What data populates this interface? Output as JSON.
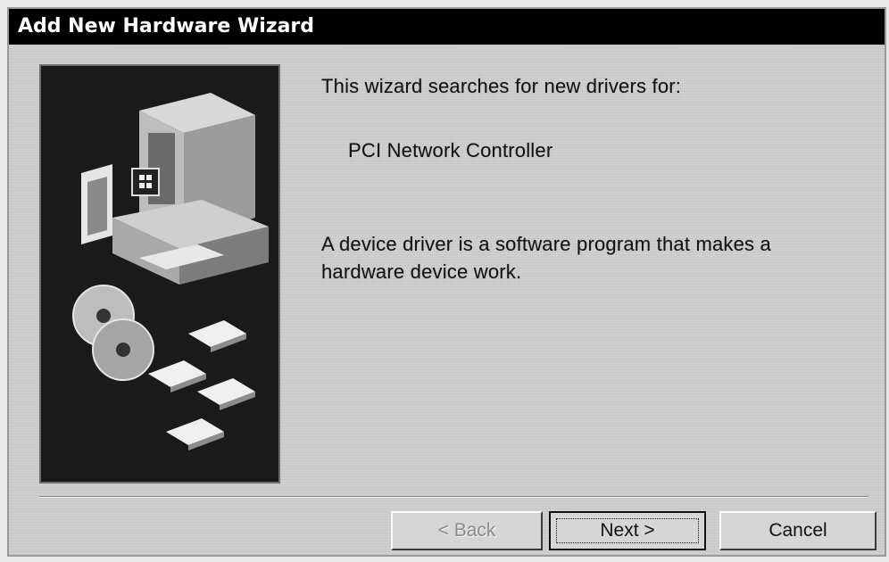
{
  "window": {
    "title": "Add New Hardware Wizard"
  },
  "content": {
    "intro": "This wizard searches for new drivers for:",
    "device_name": "PCI Network Controller",
    "description": "A device driver is a software program that makes a hardware device work."
  },
  "buttons": {
    "back_label": "< Back",
    "next_label": "Next >",
    "cancel_label": "Cancel"
  },
  "icons": {
    "illustration": "computer-with-disks-icon"
  }
}
